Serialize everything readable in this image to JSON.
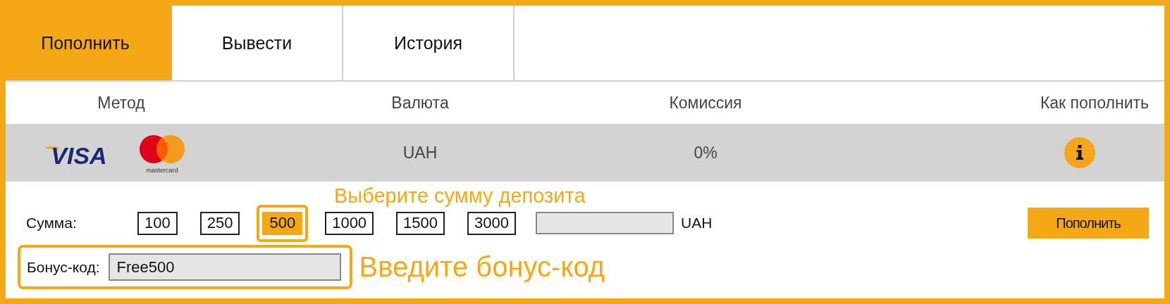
{
  "tabs": [
    {
      "label": "Пополнить",
      "selected": true
    },
    {
      "label": "Вывести",
      "selected": false
    },
    {
      "label": "История",
      "selected": false
    }
  ],
  "table": {
    "columns": [
      "Метод",
      "Валюта",
      "Комиссия",
      "Как пополнить"
    ],
    "rows": [
      {
        "visa_logo": "VISA",
        "mastercard_logo": "mastercard",
        "currency": "UAH",
        "fee": "0%"
      }
    ]
  },
  "amount": {
    "label": "Сумма:",
    "hint": "Выберите сумму депозита",
    "options": [
      {
        "label": "100",
        "selected": false
      },
      {
        "label": "250",
        "selected": false
      },
      {
        "label": "500",
        "selected": true
      },
      {
        "label": "1000",
        "selected": false
      },
      {
        "label": "1500",
        "selected": false
      },
      {
        "label": "3000",
        "selected": false
      }
    ],
    "currency": "UAH",
    "submit": "Пополнить"
  },
  "bonus": {
    "label": "Бонус-код:",
    "value": "Free500",
    "hint": "Введите бонус-код"
  }
}
